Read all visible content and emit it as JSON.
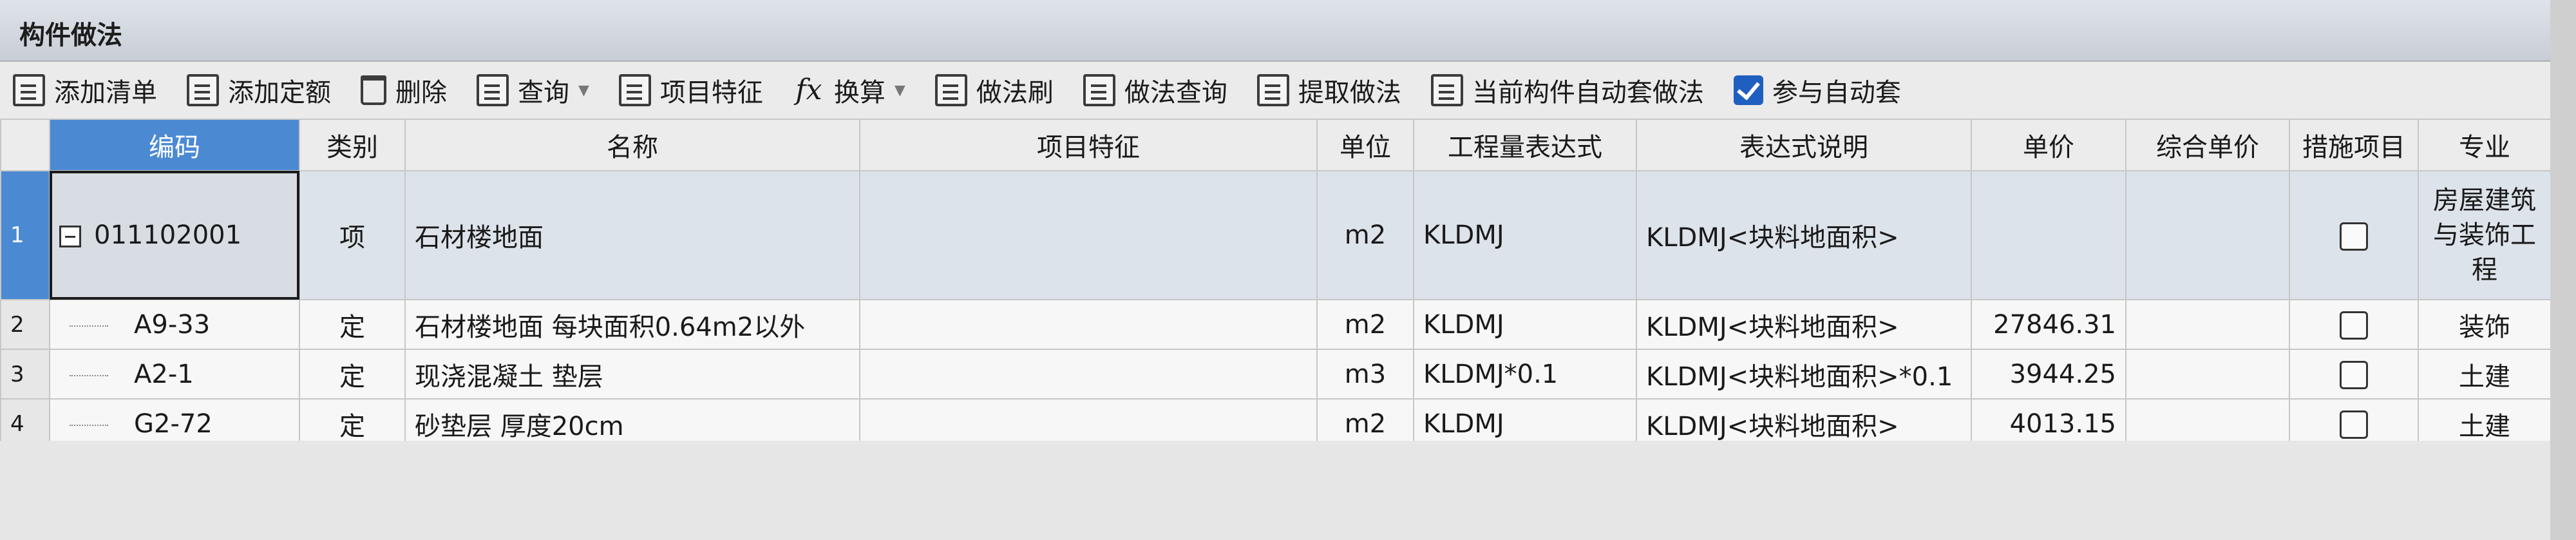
{
  "panel": {
    "title": "构件做法"
  },
  "toolbar": {
    "add_list": "添加清单",
    "add_quota": "添加定额",
    "delete": "删除",
    "query": "查询",
    "item_feature": "项目特征",
    "convert": "换算",
    "method_brush": "做法刷",
    "method_query": "做法查询",
    "extract_method": "提取做法",
    "auto_apply_current": "当前构件自动套做法",
    "participate_auto": "参与自动套"
  },
  "columns": {
    "code": "编码",
    "category": "类别",
    "name": "名称",
    "feature": "项目特征",
    "unit": "单位",
    "expr": "工程量表达式",
    "expr_desc": "表达式说明",
    "price": "单价",
    "total_price": "综合单价",
    "measure": "措施项目",
    "major": "专业"
  },
  "rows": [
    {
      "num": "1",
      "code": "011102001",
      "category": "项",
      "name": "石材楼地面",
      "feature": "",
      "unit": "m2",
      "expr": "KLDMJ",
      "expr_desc": "KLDMJ<块料地面积>",
      "price": "",
      "total_price": "",
      "major": "房屋建筑与装饰工程"
    },
    {
      "num": "2",
      "code": "A9-33",
      "category": "定",
      "name": "石材楼地面 每块面积0.64m2以外",
      "feature": "",
      "unit": "m2",
      "expr": "KLDMJ",
      "expr_desc": "KLDMJ<块料地面积>",
      "price": "27846.31",
      "total_price": "",
      "major": "装饰"
    },
    {
      "num": "3",
      "code": "A2-1",
      "category": "定",
      "name": "现浇混凝土 垫层",
      "feature": "",
      "unit": "m3",
      "expr": "KLDMJ*0.1",
      "expr_desc": "KLDMJ<块料地面积>*0.1",
      "price": "3944.25",
      "total_price": "",
      "major": "土建"
    },
    {
      "num": "4",
      "code": "G2-72",
      "category": "定",
      "name": "砂垫层 厚度20cm",
      "feature": "",
      "unit": "m2",
      "expr": "KLDMJ",
      "expr_desc": "KLDMJ<块料地面积>",
      "price": "4013.15",
      "total_price": "",
      "major": "土建"
    }
  ]
}
